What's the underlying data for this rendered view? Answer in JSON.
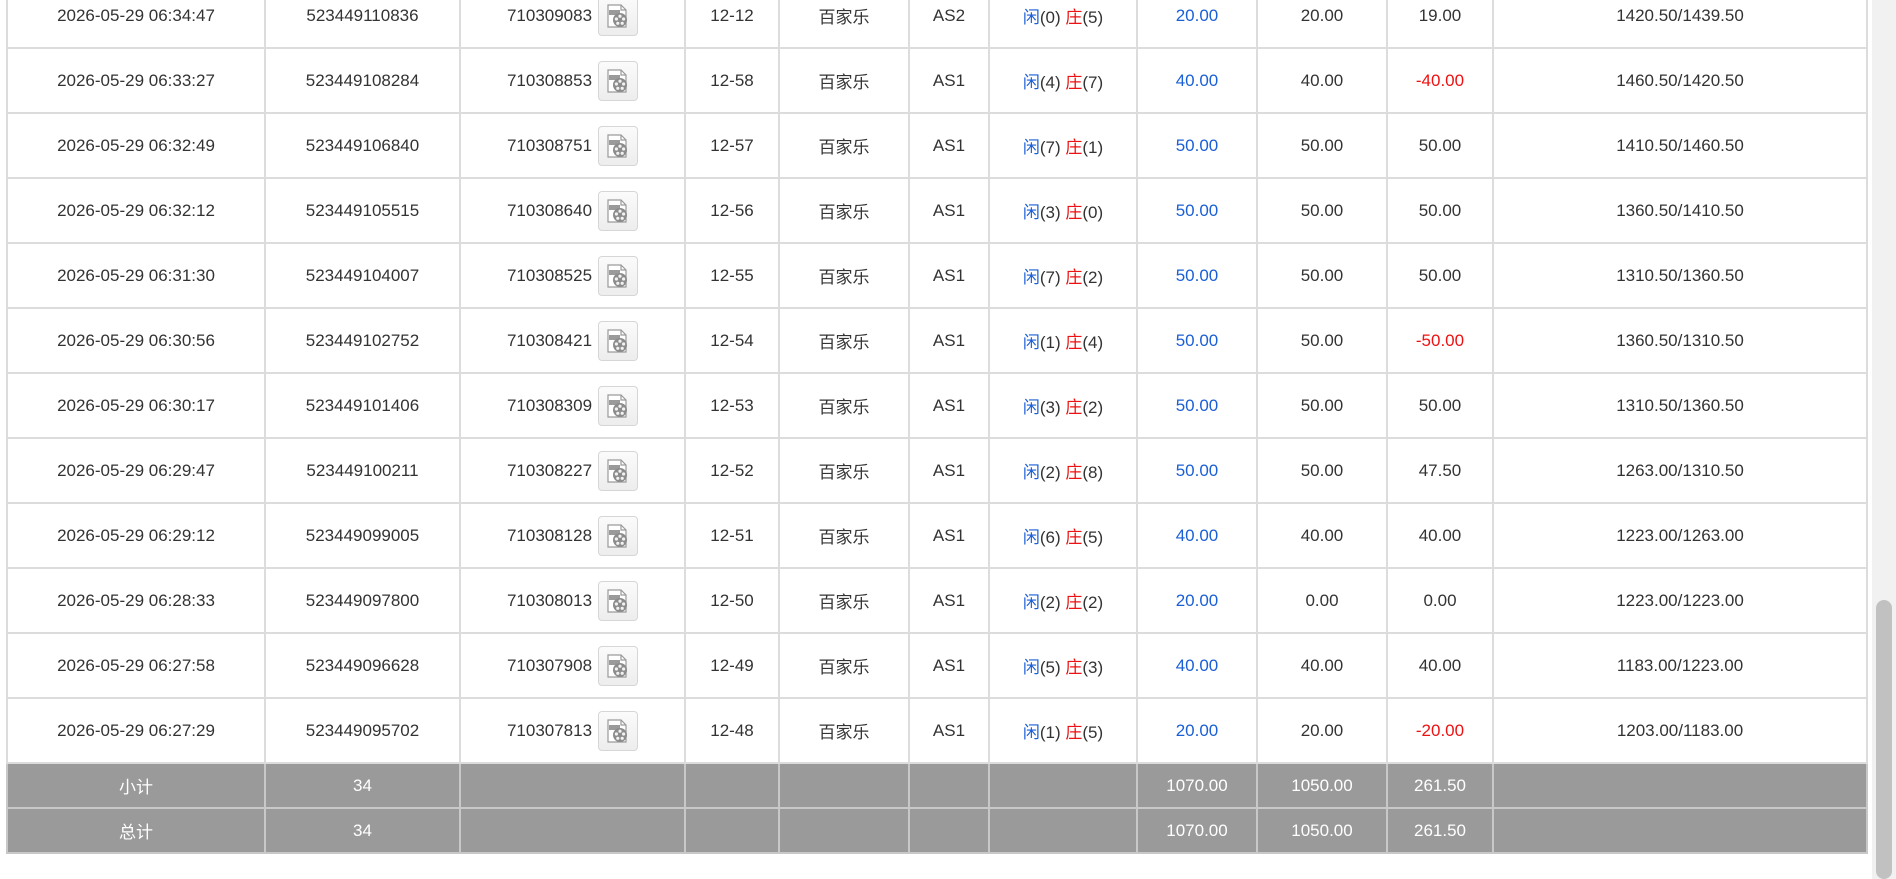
{
  "rows": [
    {
      "time": "2026-05-29 06:34:47",
      "bet_id": "523449110836",
      "game_id": "710309083",
      "shoe": "12-12",
      "game": "百家乐",
      "table": "AS2",
      "player_label": "闲",
      "player_score": "(0)",
      "banker_label": "庄",
      "banker_score": "(5)",
      "bet": "20.00",
      "valid": "20.00",
      "winloss": "19.00",
      "winloss_negative": false,
      "balance": "1420.50/1439.50"
    },
    {
      "time": "2026-05-29 06:33:27",
      "bet_id": "523449108284",
      "game_id": "710308853",
      "shoe": "12-58",
      "game": "百家乐",
      "table": "AS1",
      "player_label": "闲",
      "player_score": "(4)",
      "banker_label": "庄",
      "banker_score": "(7)",
      "bet": "40.00",
      "valid": "40.00",
      "winloss": "-40.00",
      "winloss_negative": true,
      "balance": "1460.50/1420.50"
    },
    {
      "time": "2026-05-29 06:32:49",
      "bet_id": "523449106840",
      "game_id": "710308751",
      "shoe": "12-57",
      "game": "百家乐",
      "table": "AS1",
      "player_label": "闲",
      "player_score": "(7)",
      "banker_label": "庄",
      "banker_score": "(1)",
      "bet": "50.00",
      "valid": "50.00",
      "winloss": "50.00",
      "winloss_negative": false,
      "balance": "1410.50/1460.50"
    },
    {
      "time": "2026-05-29 06:32:12",
      "bet_id": "523449105515",
      "game_id": "710308640",
      "shoe": "12-56",
      "game": "百家乐",
      "table": "AS1",
      "player_label": "闲",
      "player_score": "(3)",
      "banker_label": "庄",
      "banker_score": "(0)",
      "bet": "50.00",
      "valid": "50.00",
      "winloss": "50.00",
      "winloss_negative": false,
      "balance": "1360.50/1410.50"
    },
    {
      "time": "2026-05-29 06:31:30",
      "bet_id": "523449104007",
      "game_id": "710308525",
      "shoe": "12-55",
      "game": "百家乐",
      "table": "AS1",
      "player_label": "闲",
      "player_score": "(7)",
      "banker_label": "庄",
      "banker_score": "(2)",
      "bet": "50.00",
      "valid": "50.00",
      "winloss": "50.00",
      "winloss_negative": false,
      "balance": "1310.50/1360.50"
    },
    {
      "time": "2026-05-29 06:30:56",
      "bet_id": "523449102752",
      "game_id": "710308421",
      "shoe": "12-54",
      "game": "百家乐",
      "table": "AS1",
      "player_label": "闲",
      "player_score": "(1)",
      "banker_label": "庄",
      "banker_score": "(4)",
      "bet": "50.00",
      "valid": "50.00",
      "winloss": "-50.00",
      "winloss_negative": true,
      "balance": "1360.50/1310.50"
    },
    {
      "time": "2026-05-29 06:30:17",
      "bet_id": "523449101406",
      "game_id": "710308309",
      "shoe": "12-53",
      "game": "百家乐",
      "table": "AS1",
      "player_label": "闲",
      "player_score": "(3)",
      "banker_label": "庄",
      "banker_score": "(2)",
      "bet": "50.00",
      "valid": "50.00",
      "winloss": "50.00",
      "winloss_negative": false,
      "balance": "1310.50/1360.50"
    },
    {
      "time": "2026-05-29 06:29:47",
      "bet_id": "523449100211",
      "game_id": "710308227",
      "shoe": "12-52",
      "game": "百家乐",
      "table": "AS1",
      "player_label": "闲",
      "player_score": "(2)",
      "banker_label": "庄",
      "banker_score": "(8)",
      "bet": "50.00",
      "valid": "50.00",
      "winloss": "47.50",
      "winloss_negative": false,
      "balance": "1263.00/1310.50"
    },
    {
      "time": "2026-05-29 06:29:12",
      "bet_id": "523449099005",
      "game_id": "710308128",
      "shoe": "12-51",
      "game": "百家乐",
      "table": "AS1",
      "player_label": "闲",
      "player_score": "(6)",
      "banker_label": "庄",
      "banker_score": "(5)",
      "bet": "40.00",
      "valid": "40.00",
      "winloss": "40.00",
      "winloss_negative": false,
      "balance": "1223.00/1263.00"
    },
    {
      "time": "2026-05-29 06:28:33",
      "bet_id": "523449097800",
      "game_id": "710308013",
      "shoe": "12-50",
      "game": "百家乐",
      "table": "AS1",
      "player_label": "闲",
      "player_score": "(2)",
      "banker_label": "庄",
      "banker_score": "(2)",
      "bet": "20.00",
      "valid": "0.00",
      "winloss": "0.00",
      "winloss_negative": false,
      "balance": "1223.00/1223.00"
    },
    {
      "time": "2026-05-29 06:27:58",
      "bet_id": "523449096628",
      "game_id": "710307908",
      "shoe": "12-49",
      "game": "百家乐",
      "table": "AS1",
      "player_label": "闲",
      "player_score": "(5)",
      "banker_label": "庄",
      "banker_score": "(3)",
      "bet": "40.00",
      "valid": "40.00",
      "winloss": "40.00",
      "winloss_negative": false,
      "balance": "1183.00/1223.00"
    },
    {
      "time": "2026-05-29 06:27:29",
      "bet_id": "523449095702",
      "game_id": "710307813",
      "shoe": "12-48",
      "game": "百家乐",
      "table": "AS1",
      "player_label": "闲",
      "player_score": "(1)",
      "banker_label": "庄",
      "banker_score": "(5)",
      "bet": "20.00",
      "valid": "20.00",
      "winloss": "-20.00",
      "winloss_negative": true,
      "balance": "1203.00/1183.00"
    }
  ],
  "subtotal": {
    "label": "小计",
    "count": "34",
    "bet": "1070.00",
    "valid": "1050.00",
    "winloss": "261.50"
  },
  "total": {
    "label": "总计",
    "count": "34",
    "bet": "1070.00",
    "valid": "1050.00",
    "winloss": "261.50"
  },
  "colors": {
    "blue": "#1a5fd6",
    "red": "#ee1111",
    "summary_bg": "#9a9a9a",
    "border": "#dcdcdc"
  },
  "icons": {
    "video": "video-replay-icon"
  }
}
